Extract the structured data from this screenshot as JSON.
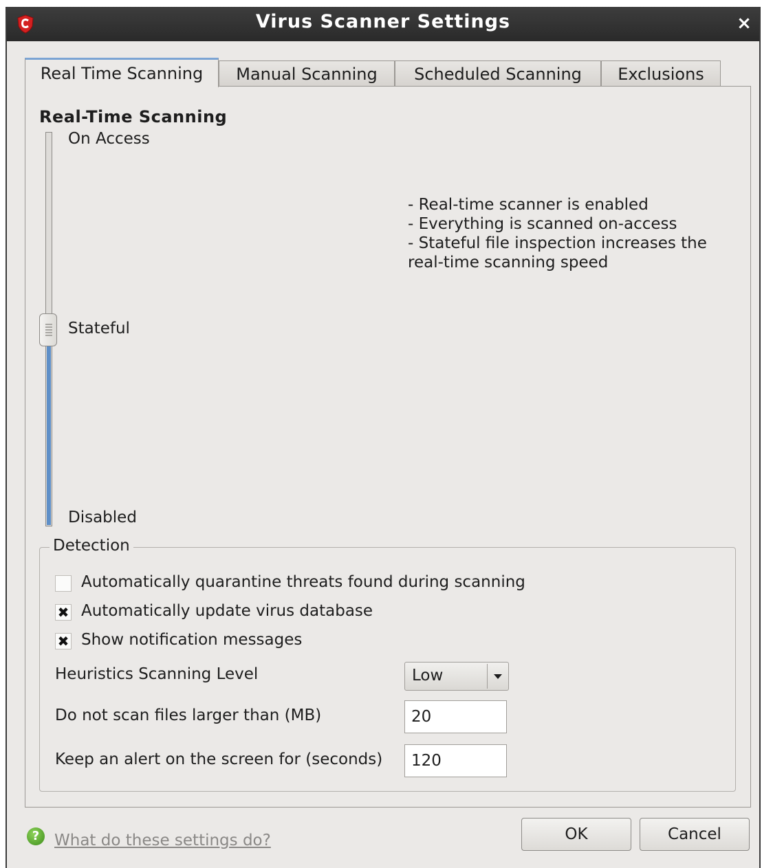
{
  "window": {
    "title": "Virus Scanner Settings",
    "app_icon": "comodo-shield-icon",
    "close_label": "×"
  },
  "tabs": [
    {
      "label": "Real Time Scanning",
      "active": true
    },
    {
      "label": "Manual Scanning",
      "active": false
    },
    {
      "label": "Scheduled Scanning",
      "active": false
    },
    {
      "label": "Exclusions",
      "active": false
    }
  ],
  "realtime": {
    "section_title": "Real-Time Scanning",
    "levels": [
      "On Access",
      "Stateful",
      "Disabled"
    ],
    "selected_level": "Stateful",
    "description": [
      "- Real-time scanner is enabled",
      "- Everything is scanned on-access",
      "- Stateful file inspection increases the",
      "real-time scanning speed"
    ]
  },
  "detection": {
    "group_label": "Detection",
    "checkboxes": [
      {
        "label": "Automatically quarantine threats found during scanning",
        "checked": false
      },
      {
        "label": "Automatically update virus database",
        "checked": true
      },
      {
        "label": "Show notification messages",
        "checked": true
      }
    ],
    "heuristics_label": "Heuristics Scanning Level",
    "heuristics_value": "Low",
    "max_size_label": "Do not scan files larger than (MB)",
    "max_size_value": "20",
    "alert_label": "Keep an alert on the screen for (seconds)",
    "alert_value": "120"
  },
  "footer": {
    "help_text": "What do these settings do?",
    "ok_label": "OK",
    "cancel_label": "Cancel"
  },
  "colors": {
    "slider_fill": "#5e8fc8",
    "titlebar": "#2f2f2f",
    "help_icon": "#4a9e22"
  }
}
